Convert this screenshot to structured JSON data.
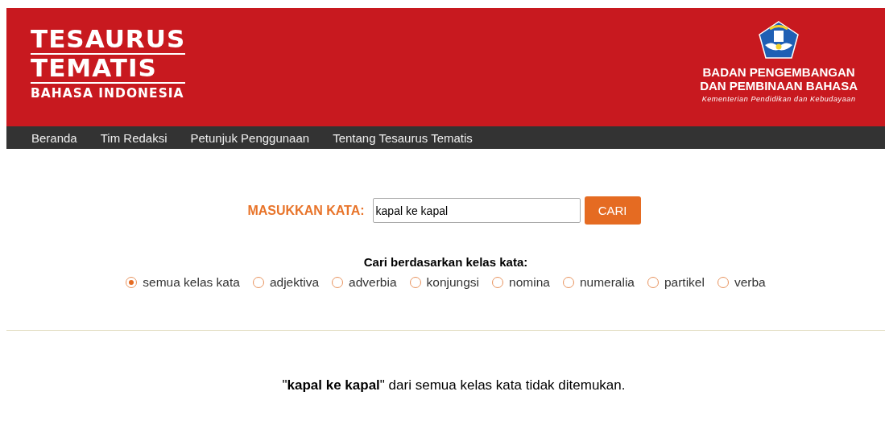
{
  "logo": {
    "line_1": "TESAURUS",
    "line_2": "TEMATIS",
    "line_3": "BAHASA INDONESIA"
  },
  "agency": {
    "line_1": "BADAN PENGEMBANGAN",
    "line_2": "DAN PEMBINAAN BAHASA",
    "ministry": "Kementerian Pendidikan dan Kebudayaan"
  },
  "nav": [
    "Beranda",
    "Tim Redaksi",
    "Petunjuk Penggunaan",
    "Tentang Tesaurus Tematis"
  ],
  "search": {
    "label": "MASUKKAN KATA:",
    "value": "kapal ke kapal",
    "button": "CARI"
  },
  "filter": {
    "title": "Cari berdasarkan kelas kata:",
    "options": [
      {
        "label": "semua kelas kata",
        "selected": true
      },
      {
        "label": "adjektiva",
        "selected": false
      },
      {
        "label": "adverbia",
        "selected": false
      },
      {
        "label": "konjungsi",
        "selected": false
      },
      {
        "label": "nomina",
        "selected": false
      },
      {
        "label": "numeralia",
        "selected": false
      },
      {
        "label": "partikel",
        "selected": false
      },
      {
        "label": "verba",
        "selected": false
      }
    ]
  },
  "result": "\"**kapal ke kapal**\" dari semua kelas kata tidak ditemukan."
}
